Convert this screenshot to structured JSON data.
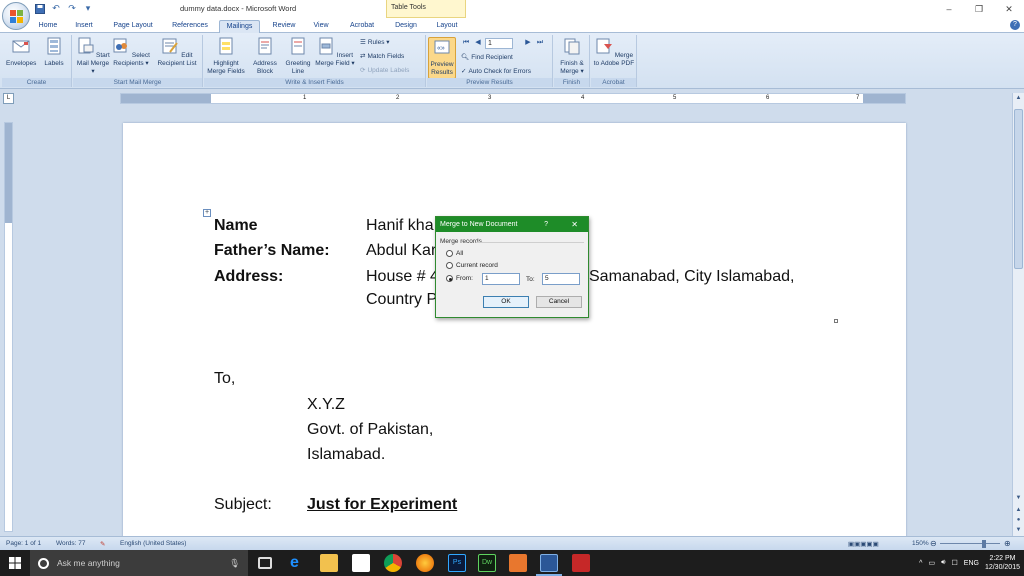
{
  "window": {
    "title": "dummy data.docx - Microsoft Word",
    "contextual_tab": "Table Tools",
    "controls": [
      "–",
      "❐",
      "✕"
    ]
  },
  "tabs": [
    "Home",
    "Insert",
    "Page Layout",
    "References",
    "Mailings",
    "Review",
    "View",
    "Acrobat",
    "Design",
    "Layout"
  ],
  "active_tab": "Mailings",
  "ribbon": {
    "create": {
      "envelopes": "Envelopes",
      "labels": "Labels",
      "group": "Create"
    },
    "start_mail_merge": {
      "start": "Start Mail Merge ▾",
      "select": "Select Recipients ▾",
      "edit": "Edit Recipient List",
      "group": "Start Mail Merge"
    },
    "write_insert": {
      "highlight": "Highlight Merge Fields",
      "address": "Address Block",
      "greeting": "Greeting Line",
      "insert": "Insert Merge Field ▾",
      "rules": "Rules ▾",
      "match": "Match Fields",
      "update": "Update Labels",
      "group": "Write & Insert Fields"
    },
    "preview": {
      "preview_btn": "Preview Results",
      "record": "1",
      "find": "Find Recipient",
      "auto_check": "Auto Check for Errors",
      "group": "Preview Results"
    },
    "finish": {
      "finish_merge": "Finish & Merge ▾",
      "group": "Finish"
    },
    "acrobat": {
      "merge_pdf": "Merge to Adobe PDF",
      "group": "Acrobat"
    }
  },
  "ruler": {
    "ticks": [
      "1",
      "2",
      "3",
      "4",
      "5",
      "6",
      "7"
    ]
  },
  "document": {
    "name_label": "Name",
    "name_value": "Hanif kha",
    "father_label": "Father’s Name:",
    "father_value": "Abdul Kar",
    "address_label": "Address:",
    "address_value_1": "House # 4",
    "address_value_1b": "Samanabad, City Islamabad,",
    "address_value_2": "Country P",
    "to": "To,",
    "to_line1": "X.Y.Z",
    "to_line2": "Govt. of Pakistan,",
    "to_line3": "Islamabad.",
    "subject_label": "Subject:",
    "subject_value": "Just for Experiment"
  },
  "dialog": {
    "title": "Merge to New Document",
    "help": "?",
    "close": "✕",
    "group_label": "Merge records",
    "option_all": "All",
    "option_current": "Current record",
    "option_from": "From:",
    "from_value": "1",
    "to_label": "To:",
    "to_value": "5",
    "ok": "OK",
    "cancel": "Cancel",
    "selected": "from"
  },
  "statusbar": {
    "page": "Page: 1 of 1",
    "words": "Words: 77",
    "language": "English (United States)",
    "zoom": "150%"
  },
  "taskbar": {
    "search_placeholder": "Ask me anything",
    "lang": "ENG",
    "time": "2:22 PM",
    "date": "12/30/2015"
  },
  "colors": {
    "dialog_title": "#1e8c28",
    "ribbon": "#d3e1f1",
    "accent": "#15428b"
  }
}
